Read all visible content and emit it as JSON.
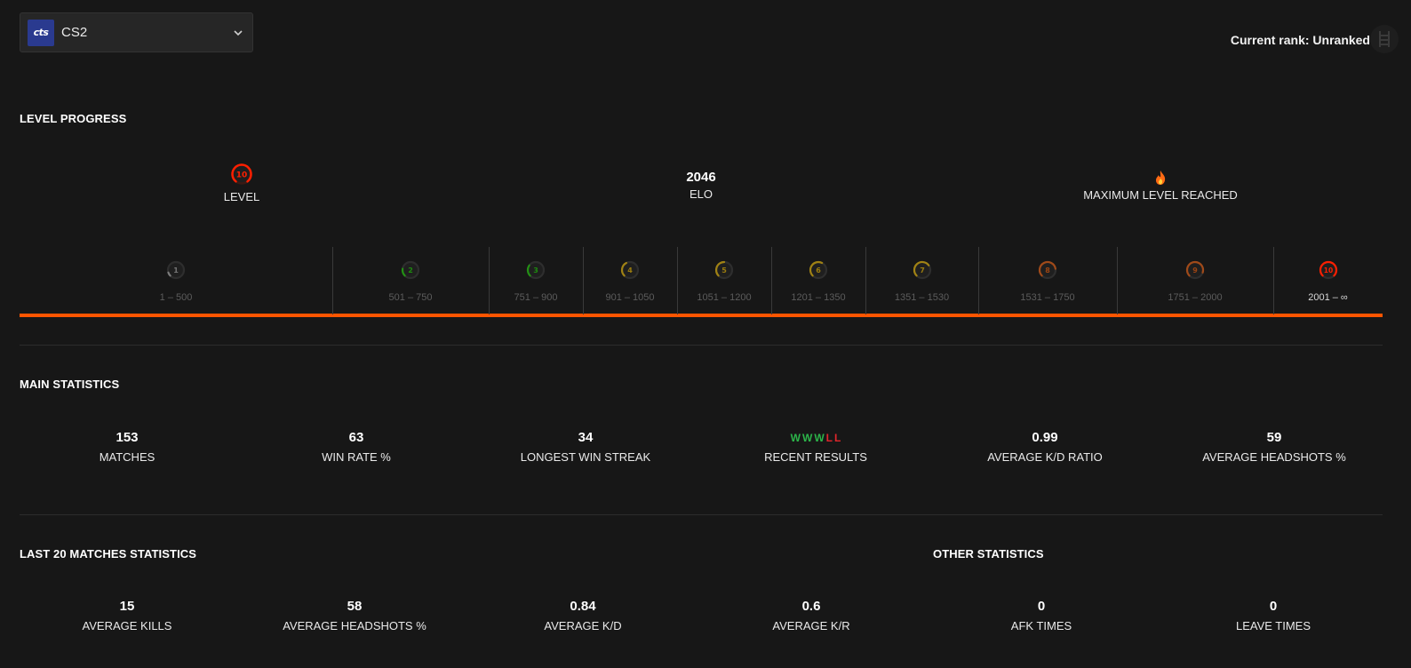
{
  "game_select": {
    "logo_text": "cts",
    "value": "CS2"
  },
  "rank": {
    "label": "Current rank: Unranked"
  },
  "level_progress": {
    "title": "LEVEL PROGRESS",
    "level": {
      "value": "10",
      "label": "LEVEL"
    },
    "elo": {
      "value": "2046",
      "label": "ELO"
    },
    "max": {
      "icon": "fire-icon",
      "label": "MAXIMUM LEVEL REACHED"
    },
    "levels": [
      {
        "level": "1",
        "range": "1 – 500",
        "color": "#bdbdbd",
        "fill": 0.1
      },
      {
        "level": "2",
        "range": "501 – 750",
        "color": "#1ce400",
        "fill": 0.2
      },
      {
        "level": "3",
        "range": "751 – 900",
        "color": "#1ce400",
        "fill": 0.3
      },
      {
        "level": "4",
        "range": "901 – 1050",
        "color": "#ffc800",
        "fill": 0.4
      },
      {
        "level": "5",
        "range": "1051 – 1200",
        "color": "#ffc800",
        "fill": 0.5
      },
      {
        "level": "6",
        "range": "1201 – 1350",
        "color": "#ffc800",
        "fill": 0.6
      },
      {
        "level": "7",
        "range": "1351 – 1530",
        "color": "#ffc800",
        "fill": 0.7
      },
      {
        "level": "8",
        "range": "1531 – 1750",
        "color": "#ff6309",
        "fill": 0.8
      },
      {
        "level": "9",
        "range": "1751 – 2000",
        "color": "#ff6309",
        "fill": 0.9
      },
      {
        "level": "10",
        "range": "2001 – ∞",
        "color": "#fe1f00",
        "fill": 1.0
      }
    ]
  },
  "main_statistics": {
    "title": "MAIN STATISTICS",
    "matches": {
      "value": "153",
      "label": "MATCHES"
    },
    "win_rate": {
      "value": "63",
      "label": "WIN RATE %"
    },
    "longest_streak": {
      "value": "34",
      "label": "LONGEST WIN STREAK"
    },
    "recent": {
      "results": [
        "W",
        "W",
        "W",
        "L",
        "L"
      ],
      "label": "RECENT RESULTS"
    },
    "kd": {
      "value": "0.99",
      "label": "AVERAGE K/D RATIO"
    },
    "hs": {
      "value": "59",
      "label": "AVERAGE HEADSHOTS %"
    }
  },
  "last20": {
    "title": "LAST 20 MATCHES STATISTICS",
    "kills": {
      "value": "15",
      "label": "AVERAGE KILLS"
    },
    "hs": {
      "value": "58",
      "label": "AVERAGE HEADSHOTS %"
    },
    "kd": {
      "value": "0.84",
      "label": "AVERAGE K/D"
    },
    "kr": {
      "value": "0.6",
      "label": "AVERAGE K/R"
    }
  },
  "other": {
    "title": "OTHER STATISTICS",
    "afk": {
      "value": "0",
      "label": "AFK TIMES"
    },
    "leave": {
      "value": "0",
      "label": "LEAVE TIMES"
    }
  },
  "colors": {
    "accent": "#ff5500",
    "win": "#2cb54a",
    "loss": "#e0262b",
    "background": "#171717"
  }
}
